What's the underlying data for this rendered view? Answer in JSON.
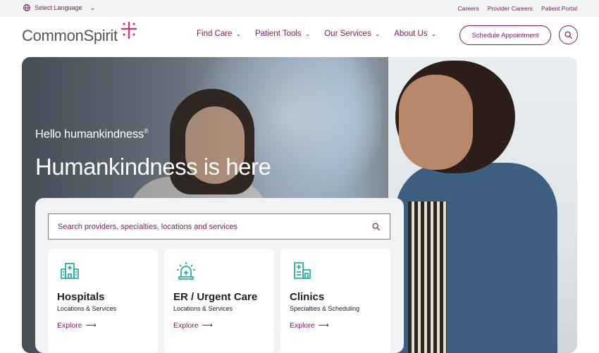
{
  "utility": {
    "language_label": "Select Language",
    "links": [
      "Careers",
      "Provider Careers",
      "Patient Portal"
    ]
  },
  "header": {
    "logo_text": "CommonSpirit",
    "nav": [
      "Find Care",
      "Patient Tools",
      "Our Services",
      "About Us"
    ],
    "appointment_button": "Schedule Appointment"
  },
  "hero": {
    "eyebrow": "Hello humankindness",
    "eyebrow_mark": "®",
    "headline": "Humankindness is here",
    "search_placeholder": "Search providers, specialties, locations and services"
  },
  "cards": [
    {
      "icon": "hospital-icon",
      "title": "Hospitals",
      "subtitle": "Locations & Services",
      "link": "Explore"
    },
    {
      "icon": "siren-icon",
      "title": "ER / Urgent Care",
      "subtitle": "Locations & Services",
      "link": "Explore"
    },
    {
      "icon": "clinic-icon",
      "title": "Clinics",
      "subtitle": "Specialties & Scheduling",
      "link": "Explore"
    }
  ],
  "colors": {
    "brand": "#7b1c5c",
    "accent_teal": "#1aa59a",
    "logo_magenta": "#c23b8f"
  }
}
